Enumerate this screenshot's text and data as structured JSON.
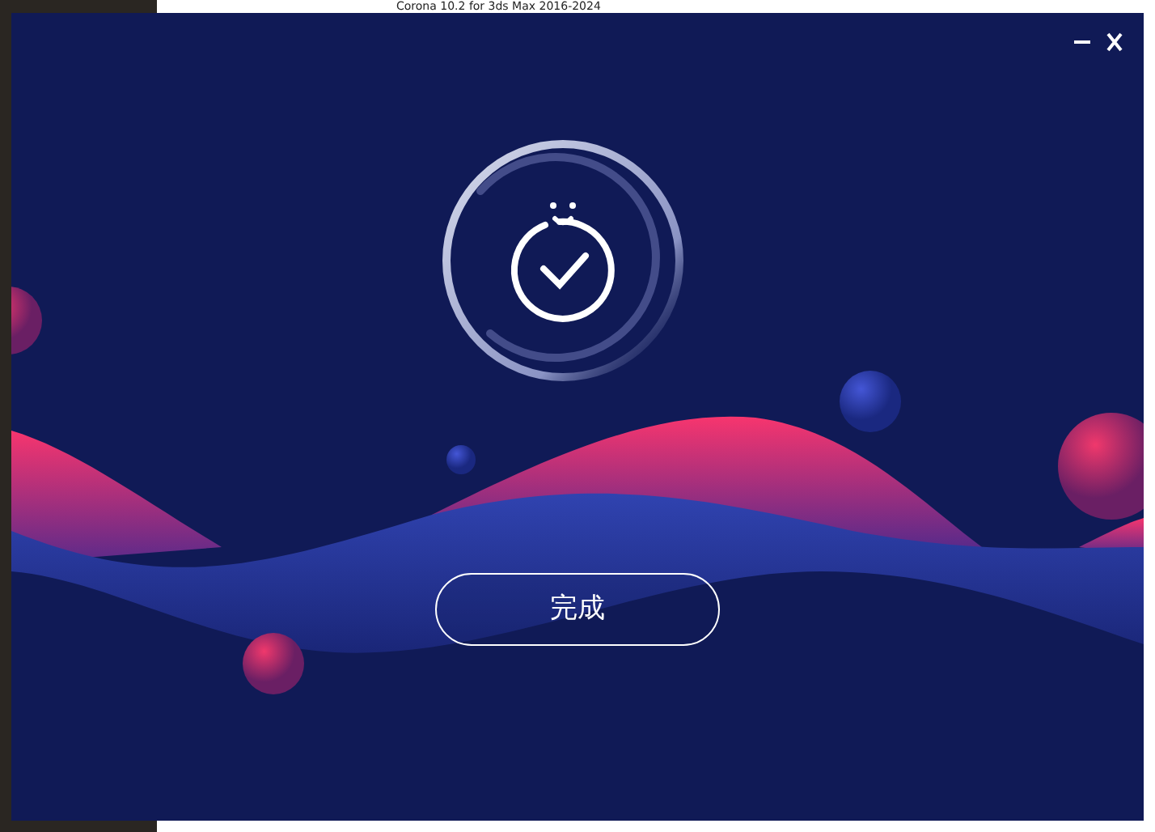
{
  "background_window": {
    "title": "Corona 10.2 for 3ds Max 2016-2024"
  },
  "installer": {
    "finish_button": {
      "label": "完成"
    }
  }
}
